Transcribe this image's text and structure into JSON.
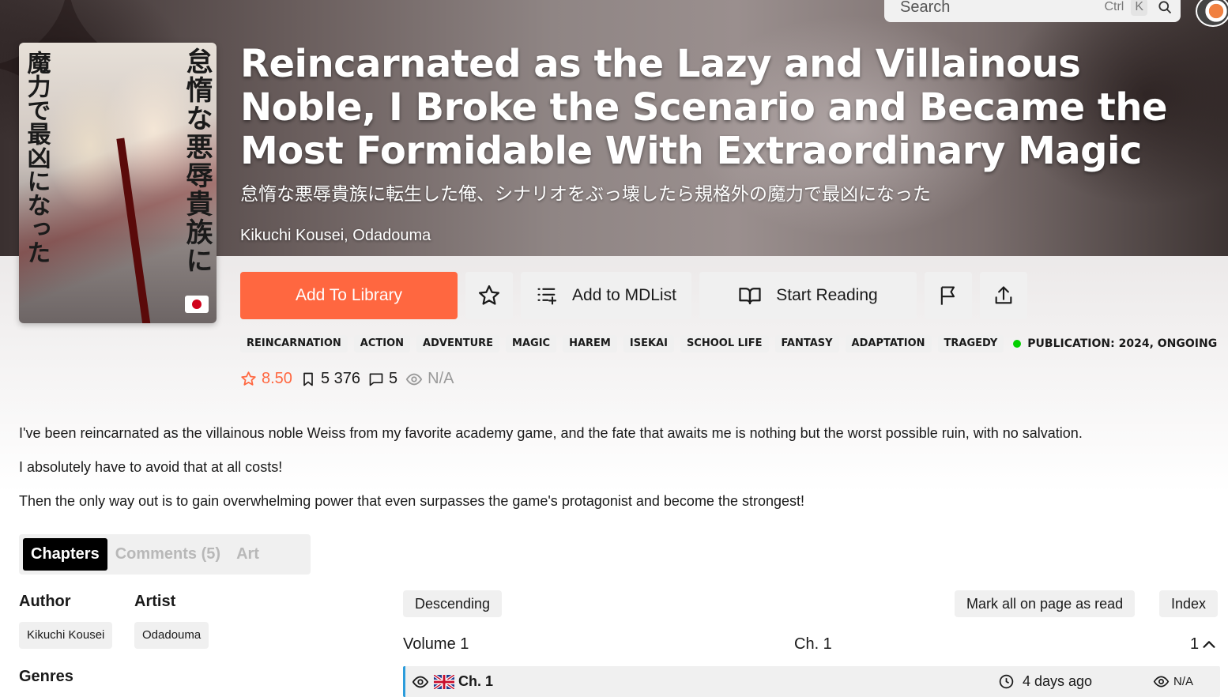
{
  "search": {
    "placeholder": "Search",
    "kbd_ctrl": "Ctrl",
    "kbd_k": "K"
  },
  "manga": {
    "title": "Reincarnated as the Lazy and Villainous Noble, I Broke the Scenario and Became the Most Formidable With Extraordinary Magic",
    "alt_title": "怠惰な悪辱貴族に転生した俺、シナリオをぶっ壊したら規格外の魔力で最凶になった",
    "authors": "Kikuchi Kousei, Odadouma",
    "cover_text_right": "怠惰な悪辱貴族に",
    "cover_text_left": "魔力で最凶になった",
    "language_flag": "japan-flag"
  },
  "actions": {
    "add_library": "Add To Library",
    "add_mdlist": "Add to MDList",
    "start_reading": "Start Reading"
  },
  "tags": [
    "REINCARNATION",
    "ACTION",
    "ADVENTURE",
    "MAGIC",
    "HAREM",
    "ISEKAI",
    "SCHOOL LIFE",
    "FANTASY",
    "ADAPTATION",
    "TRAGEDY"
  ],
  "publication": {
    "label": "PUBLICATION: 2024, ONGOING",
    "status_color": "#04d000"
  },
  "stats": {
    "rating": "8.50",
    "follows": "5 376",
    "comments": "5",
    "views": "N/A"
  },
  "description": [
    "I've been reincarnated as the villainous noble Weiss from my favorite academy game, and the fate that awaits me is nothing but the worst possible ruin, with no salvation.",
    "I absolutely have to avoid that at all costs!",
    "Then the only way out is to gain overwhelming power that even surpasses the game's protagonist and become the strongest!"
  ],
  "tabs": [
    "Chapters",
    "Comments (5)",
    "Art"
  ],
  "info": {
    "author_heading": "Author",
    "artist_heading": "Artist",
    "author": "Kikuchi Kousei",
    "artist": "Odadouma",
    "genres_heading": "Genres"
  },
  "chapters": {
    "sort_label": "Descending",
    "mark_read_label": "Mark all on page as read",
    "index_label": "Index",
    "volume_label": "Volume 1",
    "chapter_range": "Ch. 1",
    "count": "1",
    "rows": [
      {
        "title": "Ch. 1",
        "time": "4 days ago",
        "views": "N/A",
        "flag": "uk-flag"
      }
    ]
  },
  "colors": {
    "accent": "#ff6740",
    "read_marker": "#2c9cdb"
  }
}
